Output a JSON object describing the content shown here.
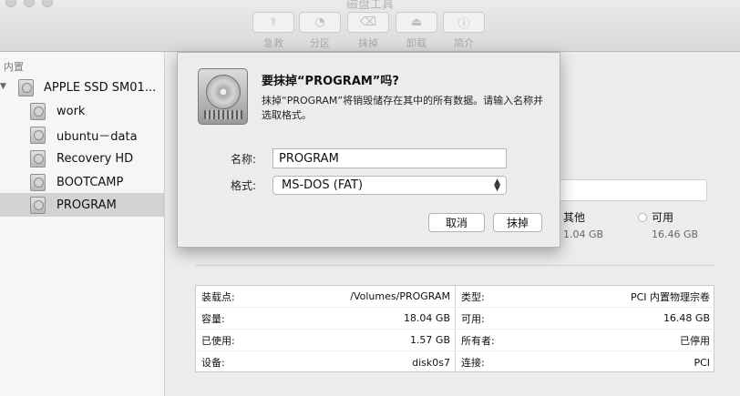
{
  "window": {
    "title": "磁盘工具"
  },
  "toolbar": {
    "buttons": [
      {
        "label": "急救",
        "icon": "stethoscope-icon"
      },
      {
        "label": "分区",
        "icon": "pie-chart-icon"
      },
      {
        "label": "抹掉",
        "icon": "erase-icon"
      },
      {
        "label": "卸载",
        "icon": "eject-icon"
      },
      {
        "label": "简介",
        "icon": "info-icon"
      }
    ]
  },
  "sidebar": {
    "section": "内置",
    "items": [
      {
        "label": "APPLE SSD SM01..."
      },
      {
        "label": "work"
      },
      {
        "label": "ubuntu－data"
      },
      {
        "label": "Recovery HD"
      },
      {
        "label": "BOOTCAMP"
      },
      {
        "label": "PROGRAM"
      }
    ]
  },
  "usage": {
    "other_label": "其他",
    "other_value": "1.04 GB",
    "free_label": "可用",
    "free_value": "16.46 GB"
  },
  "info": {
    "left": [
      {
        "label": "装载点:",
        "value": "/Volumes/PROGRAM"
      },
      {
        "label": "容量:",
        "value": "18.04 GB"
      },
      {
        "label": "已使用:",
        "value": "1.57 GB"
      },
      {
        "label": "设备:",
        "value": "disk0s7"
      }
    ],
    "right": [
      {
        "label": "类型:",
        "value": "PCI 内置物理宗卷"
      },
      {
        "label": "可用:",
        "value": "16.48 GB"
      },
      {
        "label": "所有者:",
        "value": "已停用"
      },
      {
        "label": "连接:",
        "value": "PCI"
      }
    ]
  },
  "dialog": {
    "title": "要抹掉“PROGRAM”吗?",
    "message": "抹掉“PROGRAM”将销毁储存在其中的所有数据。请输入名称并选取格式。",
    "name_label": "名称:",
    "name_value": "PROGRAM",
    "format_label": "格式:",
    "format_value": "MS-DOS (FAT)",
    "cancel_label": "取消",
    "erase_label": "抹掉"
  },
  "colors": {
    "selection": "#d3d3d3",
    "dialog_bg": "#ececec"
  }
}
